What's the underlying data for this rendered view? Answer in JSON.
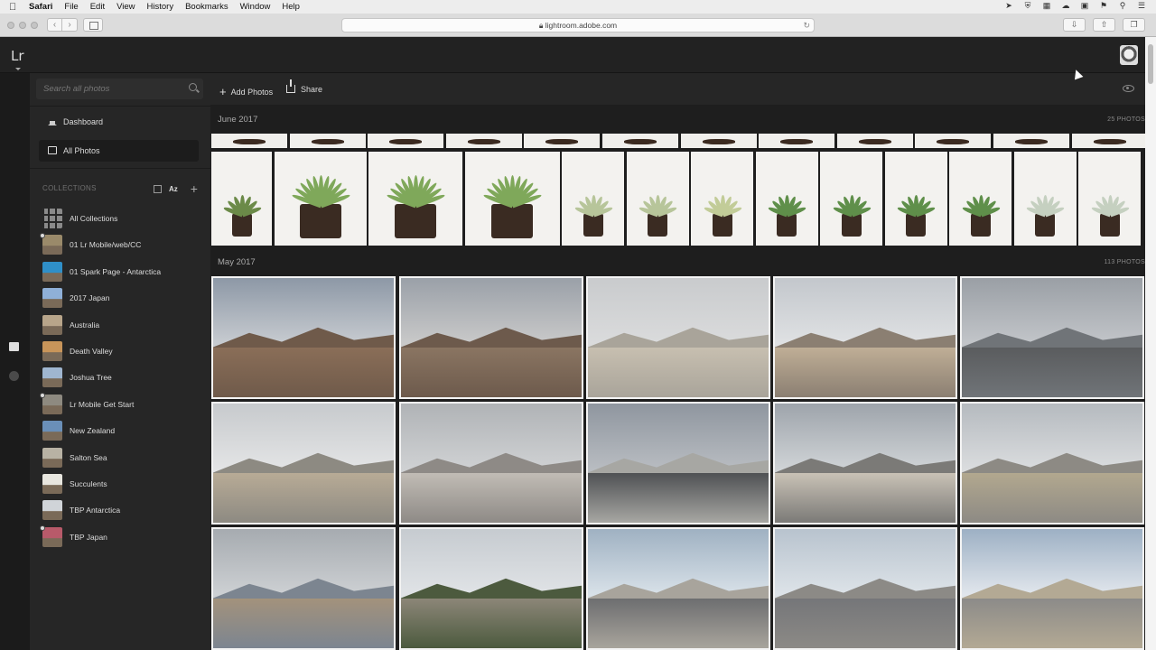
{
  "menubar": {
    "app": "Safari",
    "items": [
      "File",
      "Edit",
      "View",
      "History",
      "Bookmarks",
      "Window",
      "Help"
    ]
  },
  "browser": {
    "url": "lightroom.adobe.com"
  },
  "app": {
    "logo": "Lr",
    "search_placeholder": "Search all photos",
    "nav": [
      {
        "label": "Dashboard",
        "icon": "home-icon"
      },
      {
        "label": "All Photos",
        "icon": "photos-icon",
        "selected": true
      }
    ],
    "collections_header": "COLLECTIONS",
    "sort_label": "Az",
    "collections": [
      {
        "label": "All Collections",
        "thumb": "#8a8a8a",
        "sync": false
      },
      {
        "label": "01 Lr Mobile/web/CC",
        "thumb": "#9a8a6a",
        "sync": true
      },
      {
        "label": "01 Spark Page - Antarctica",
        "thumb": "#2f8fc8",
        "sync": false
      },
      {
        "label": "2017 Japan",
        "thumb": "#8fb0d8",
        "sync": false
      },
      {
        "label": "Australia",
        "thumb": "#b8a58a",
        "sync": false
      },
      {
        "label": "Death Valley",
        "thumb": "#c8955a",
        "sync": false
      },
      {
        "label": "Joshua Tree",
        "thumb": "#9fb6d0",
        "sync": false
      },
      {
        "label": "Lr Mobile Get Start",
        "thumb": "#8e8a80",
        "sync": true
      },
      {
        "label": "New Zealand",
        "thumb": "#6a8fb8",
        "sync": false
      },
      {
        "label": "Salton Sea",
        "thumb": "#b8b2a4",
        "sync": false
      },
      {
        "label": "Succulents",
        "thumb": "#e8e6df",
        "sync": false
      },
      {
        "label": "TBP Antarctica",
        "thumb": "#d0d4d8",
        "sync": false
      },
      {
        "label": "TBP Japan",
        "thumb": "#b85a6a",
        "sync": true
      }
    ]
  },
  "toolbar": {
    "add_photos": "Add Photos",
    "share": "Share"
  },
  "sections": [
    {
      "date": "June 2017",
      "count": "25 PHOTOS"
    },
    {
      "date": "May 2017",
      "count": "113 PHOTOS"
    }
  ],
  "colors": {
    "app_bg": "#1e1e1e",
    "sidebar_bg": "#262626",
    "text": "#dddddd"
  }
}
